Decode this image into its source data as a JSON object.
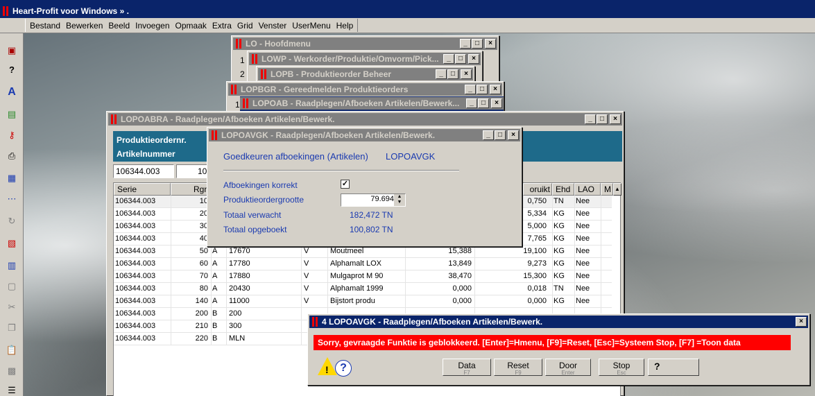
{
  "app": {
    "title": "Heart-Profit voor Windows  » ."
  },
  "menu": [
    "Bestand",
    "Bewerken",
    "Beeld",
    "Invoegen",
    "Opmaak",
    "Extra",
    "Grid",
    "Venster",
    "UserMenu",
    "Help"
  ],
  "windows": {
    "lo": "LO - Hoofdmenu",
    "lowp": "LOWP - Werkorder/Produktie/Omvorm/Pick...",
    "lopb": "LOPB - Produktieorder Beheer",
    "lopbgr": "LOPBGR - Gereedmelden Produktieorders",
    "lopoab": "LOPOAB - Raadplegen/Afboeken Artikelen/Bewerk...",
    "lopoabra": "LOPOABRA - Raadplegen/Afboeken Artikelen/Bewerk.",
    "lopoavgk": "LOPOAVGK - Raadplegen/Afboeken Artikelen/Bewerk.",
    "error": "4 LOPOAVGK - Raadplegen/Afboeken Artikelen/Bewerk."
  },
  "list_numbers": [
    "1",
    "2",
    "1"
  ],
  "lopoabra": {
    "label_order": "Produktieordernr.",
    "label_artikel": "Artikelnummer",
    "field_order": "106344.003",
    "field_second": "10",
    "columns": [
      "Serie",
      "Rgn",
      "oruikt",
      "Ehd",
      "LAO",
      "M"
    ],
    "rows": [
      {
        "serie": "106344.003",
        "rgn": "10",
        "c": "",
        "art": "",
        "v": "",
        "oms": "",
        "exp": "",
        "used": "0,750",
        "ehd": "TN",
        "lao": "Nee"
      },
      {
        "serie": "106344.003",
        "rgn": "20",
        "c": "",
        "art": "",
        "v": "",
        "oms": "",
        "exp": "",
        "used": "5,334",
        "ehd": "KG",
        "lao": "Nee"
      },
      {
        "serie": "106344.003",
        "rgn": "30",
        "c": "",
        "art": "",
        "v": "",
        "oms": "",
        "exp": "",
        "used": "5,000",
        "ehd": "KG",
        "lao": "Nee"
      },
      {
        "serie": "106344.003",
        "rgn": "40",
        "c": "",
        "art": "",
        "v": "",
        "oms": "",
        "exp": "",
        "used": "7,765",
        "ehd": "KG",
        "lao": "Nee"
      },
      {
        "serie": "106344.003",
        "rgn": "50",
        "c": "A",
        "art": "17670",
        "v": "V",
        "oms": "Moutmeel",
        "exp": "15,388",
        "used": "19,100",
        "ehd": "KG",
        "lao": "Nee"
      },
      {
        "serie": "106344.003",
        "rgn": "60",
        "c": "A",
        "art": "17780",
        "v": "V",
        "oms": "Alphamalt LOX",
        "exp": "13,849",
        "used": "9,273",
        "ehd": "KG",
        "lao": "Nee"
      },
      {
        "serie": "106344.003",
        "rgn": "70",
        "c": "A",
        "art": "17880",
        "v": "V",
        "oms": "Mulgaprot M 90",
        "exp": "38,470",
        "used": "15,300",
        "ehd": "KG",
        "lao": "Nee"
      },
      {
        "serie": "106344.003",
        "rgn": "80",
        "c": "A",
        "art": "20430",
        "v": "V",
        "oms": "Alphamalt 1999",
        "exp": "0,000",
        "used": "0,018",
        "ehd": "TN",
        "lao": "Nee"
      },
      {
        "serie": "106344.003",
        "rgn": "140",
        "c": "A",
        "art": "11000",
        "v": "V",
        "oms": "Bijstort produ",
        "exp": "0,000",
        "used": "0,000",
        "ehd": "KG",
        "lao": "Nee"
      },
      {
        "serie": "106344.003",
        "rgn": "200",
        "c": "B",
        "art": "200",
        "v": "",
        "oms": "",
        "exp": "",
        "used": "",
        "ehd": "",
        "lao": ""
      },
      {
        "serie": "106344.003",
        "rgn": "210",
        "c": "B",
        "art": "300",
        "v": "",
        "oms": "",
        "exp": "",
        "used": "",
        "ehd": "",
        "lao": ""
      },
      {
        "serie": "106344.003",
        "rgn": "220",
        "c": "B",
        "art": "MLN",
        "v": "",
        "oms": "",
        "exp": "",
        "used": "",
        "ehd": "",
        "lao": ""
      }
    ]
  },
  "lopoavgk": {
    "heading": "Goedkeuren afboekingen (Artikelen)",
    "code": "LOPOAVGK",
    "label_correct": "Afboekingen korrekt",
    "label_size": "Produktieordergrootte",
    "value_size": "79.694",
    "label_expected": "Totaal verwacht",
    "value_expected": "182,472 TN",
    "label_booked": "Totaal opgeboekt",
    "value_booked": "100,802 TN"
  },
  "error": {
    "message": "Sorry, gevraagde Funktie is geblokkeerd.  [Enter]=Hmenu, [F9]=Reset, [Esc]=Systeem Stop, [F7] =Toon data",
    "buttons": [
      {
        "label": "Data",
        "key": "F7"
      },
      {
        "label": "Reset",
        "key": "F9"
      },
      {
        "label": "Door",
        "key": "Enter"
      },
      {
        "label": "Stop",
        "key": "Esc"
      }
    ]
  },
  "colors": {
    "title_active": "#0a246a",
    "error_red": "#ff0000",
    "header_teal": "#1e6a8a"
  }
}
